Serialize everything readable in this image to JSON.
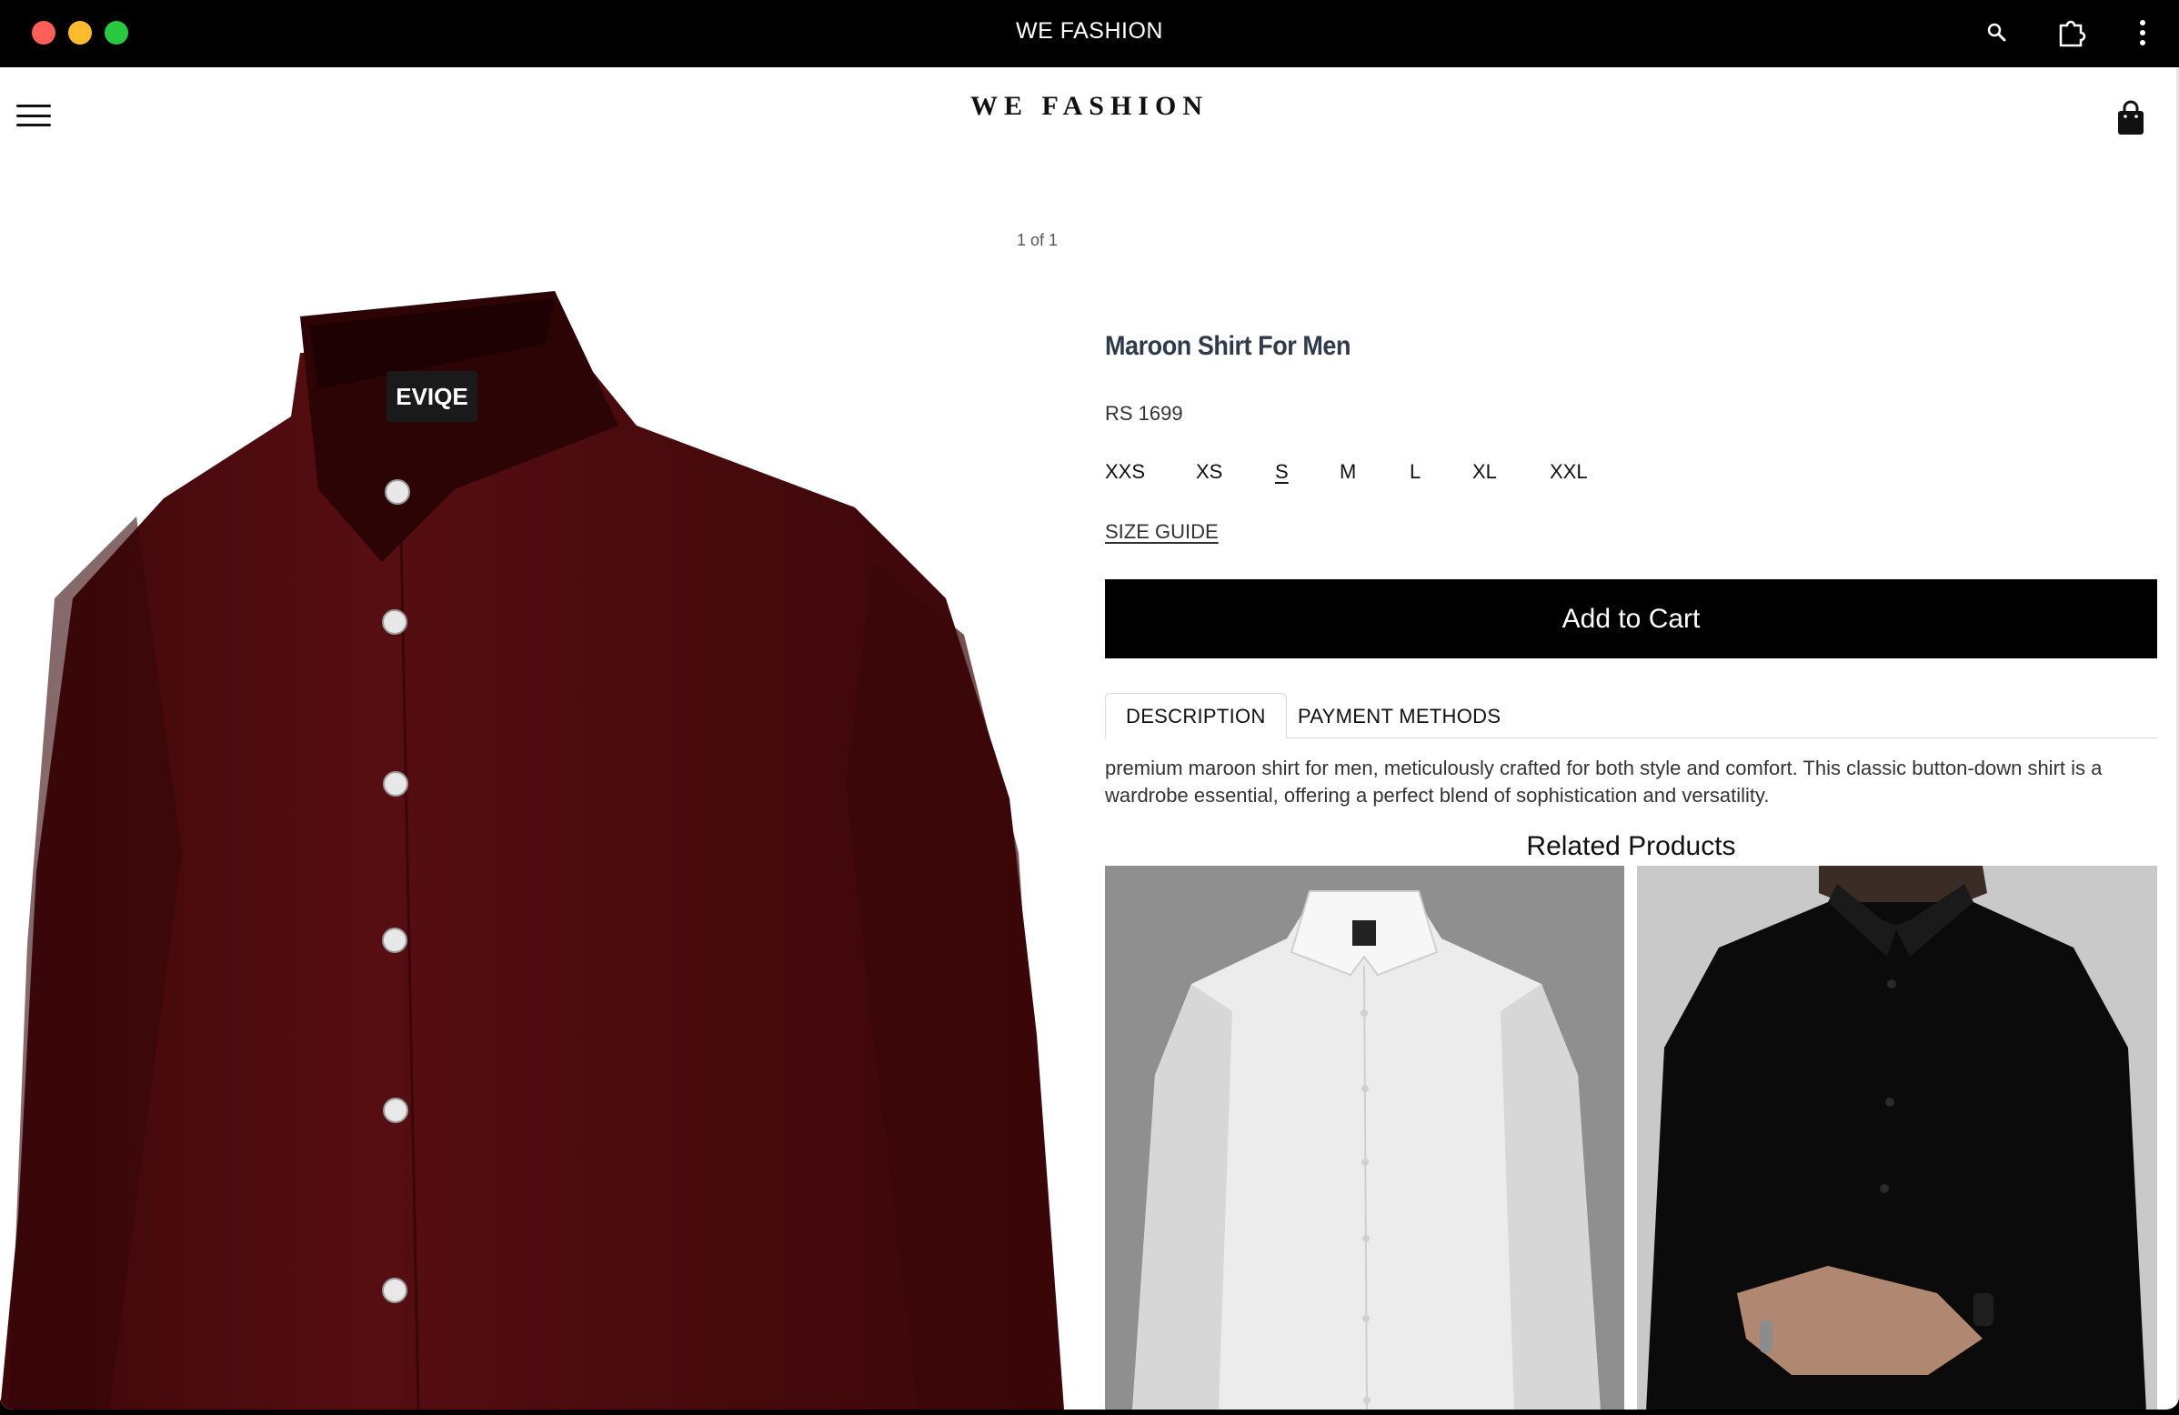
{
  "window": {
    "title": "WE FASHION"
  },
  "header": {
    "brand": "WE FASHION"
  },
  "gallery": {
    "counter": "1 of 1",
    "label_text": "EVIQE"
  },
  "product": {
    "title": "Maroon Shirt For Men",
    "price": "RS 1699",
    "sizes": [
      "XXS",
      "XS",
      "S",
      "M",
      "L",
      "XL",
      "XXL"
    ],
    "selected_size": "S",
    "size_guide": "SIZE GUIDE",
    "add_to_cart": "Add to Cart"
  },
  "tabs": [
    {
      "label": "DESCRIPTION",
      "active": true
    },
    {
      "label": "PAYMENT METHODS",
      "active": false
    }
  ],
  "description": "premium maroon shirt for men, meticulously crafted for both style and comfort. This classic button-down shirt is a wardrobe essential, offering a perfect blend of sophistication and versatility.",
  "related": {
    "title": "Related Products",
    "items": [
      {
        "name": "white-shirt-product"
      },
      {
        "name": "black-shirt-product"
      }
    ]
  },
  "colors": {
    "shirt": "#4a0b0e",
    "accent": "#000000"
  },
  "icons": [
    "search-icon",
    "extensions-icon",
    "more-options-icon",
    "menu-icon",
    "shopping-bag-icon"
  ]
}
